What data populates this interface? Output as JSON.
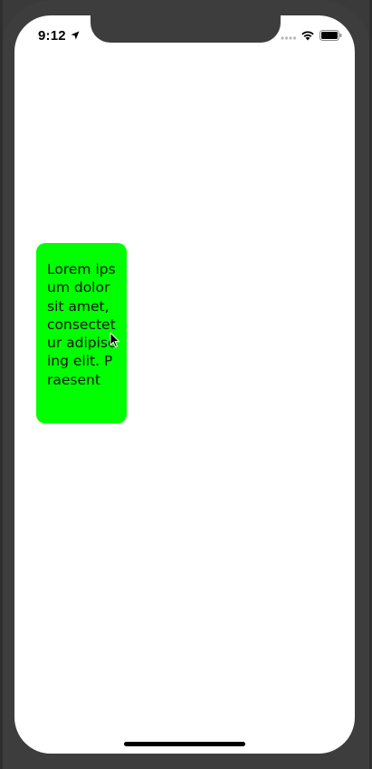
{
  "status_bar": {
    "time": "9:12",
    "icons": [
      "location-arrow-icon",
      "cellular-signal-icon",
      "wifi-icon",
      "battery-icon"
    ]
  },
  "card": {
    "text": "Lorem ipsum dolor sit amet, consectetur adipiscing elit. Praesent",
    "background_color": "#00ff00"
  },
  "pointer": {
    "icon": "arrow-cursor-icon"
  },
  "colors": {
    "device_frame": "#3d3d3d",
    "screen_background": "#ffffff",
    "card_green": "#00ff00"
  }
}
